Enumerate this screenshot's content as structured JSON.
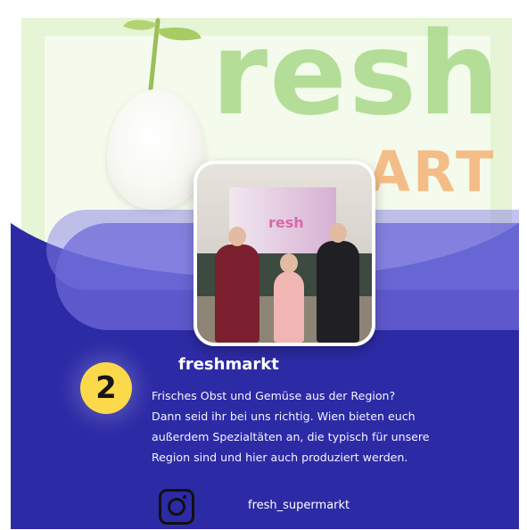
{
  "post": {
    "logo": {
      "word": "resh",
      "sub": "ART"
    },
    "photo_screen_text": "resh",
    "number_badge": "2",
    "title": "freshmarkt",
    "description_lines": [
      "Frisches Obst und Gemüse aus der Region?",
      "Dann seid ihr bei uns richtig. Wien bieten euch",
      "außerdem Spezialtäten an, die typisch für unsere",
      "Region sind und hier auch produziert werden."
    ],
    "instagram_icon": "instagram-icon",
    "instagram_handle": "fresh_supermarkt",
    "colors": {
      "background": "#2d2aa6",
      "badge": "#fcd94a",
      "logo_green": "#a8d98a",
      "logo_orange": "#f4a35d"
    }
  }
}
